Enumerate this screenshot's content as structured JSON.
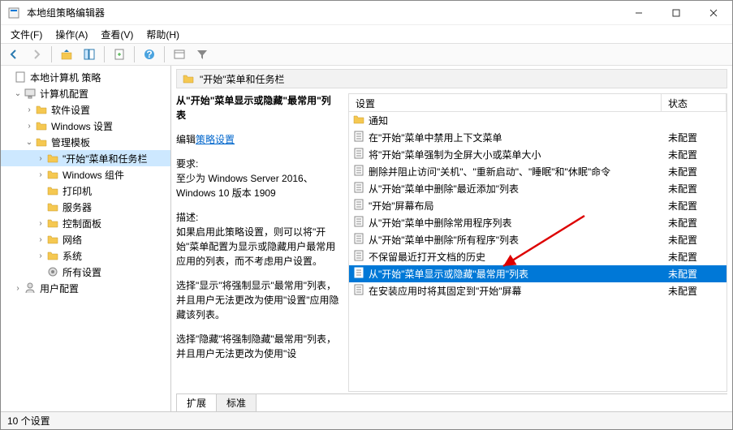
{
  "window": {
    "title": "本地组策略编辑器"
  },
  "menu": {
    "file": "文件(F)",
    "action": "操作(A)",
    "view": "查看(V)",
    "help": "帮助(H)"
  },
  "tree": {
    "root": "本地计算机 策略",
    "computer_config": "计算机配置",
    "software": "软件设置",
    "windows_settings": "Windows 设置",
    "admin_templates": "管理模板",
    "start_taskbar": "\"开始\"菜单和任务栏",
    "windows_components": "Windows 组件",
    "printers": "打印机",
    "server": "服务器",
    "control_panel": "控制面板",
    "network": "网络",
    "system": "系统",
    "all_settings": "所有设置",
    "user_config": "用户配置"
  },
  "header": {
    "path": "\"开始\"菜单和任务栏"
  },
  "desc": {
    "title": "从\"开始\"菜单显示或隐藏\"最常用\"列表",
    "edit_label": "编辑",
    "edit_link": "策略设置",
    "req_label": "要求:",
    "req_text": "至少为 Windows Server 2016、Windows 10 版本 1909",
    "desc_label": "描述:",
    "desc_p1": "如果启用此策略设置，则可以将\"开始\"菜单配置为显示或隐藏用户最常用应用的列表，而不考虑用户设置。",
    "desc_p2": "选择\"显示\"将强制显示\"最常用\"列表，并且用户无法更改为使用\"设置\"应用隐藏该列表。",
    "desc_p3": "选择\"隐藏\"将强制隐藏\"最常用\"列表，并且用户无法更改为使用\"设"
  },
  "columns": {
    "setting": "设置",
    "state": "状态"
  },
  "rows": [
    {
      "type": "folder",
      "name": "通知",
      "state": ""
    },
    {
      "type": "policy",
      "name": "在\"开始\"菜单中禁用上下文菜单",
      "state": "未配置"
    },
    {
      "type": "policy",
      "name": "将\"开始\"菜单强制为全屏大小或菜单大小",
      "state": "未配置"
    },
    {
      "type": "policy",
      "name": "删除并阻止访问\"关机\"、\"重新启动\"、\"睡眠\"和\"休眠\"命令",
      "state": "未配置"
    },
    {
      "type": "policy",
      "name": "从\"开始\"菜单中删除\"最近添加\"列表",
      "state": "未配置"
    },
    {
      "type": "policy",
      "name": "\"开始\"屏幕布局",
      "state": "未配置"
    },
    {
      "type": "policy",
      "name": "从\"开始\"菜单中删除常用程序列表",
      "state": "未配置"
    },
    {
      "type": "policy",
      "name": "从\"开始\"菜单中删除\"所有程序\"列表",
      "state": "未配置"
    },
    {
      "type": "policy",
      "name": "不保留最近打开文档的历史",
      "state": "未配置"
    },
    {
      "type": "policy",
      "name": "从\"开始\"菜单显示或隐藏\"最常用\"列表",
      "state": "未配置",
      "selected": true
    },
    {
      "type": "policy",
      "name": "在安装应用时将其固定到\"开始\"屏幕",
      "state": "未配置"
    }
  ],
  "tabs": {
    "extended": "扩展",
    "standard": "标准"
  },
  "status": {
    "text": "10 个设置"
  }
}
